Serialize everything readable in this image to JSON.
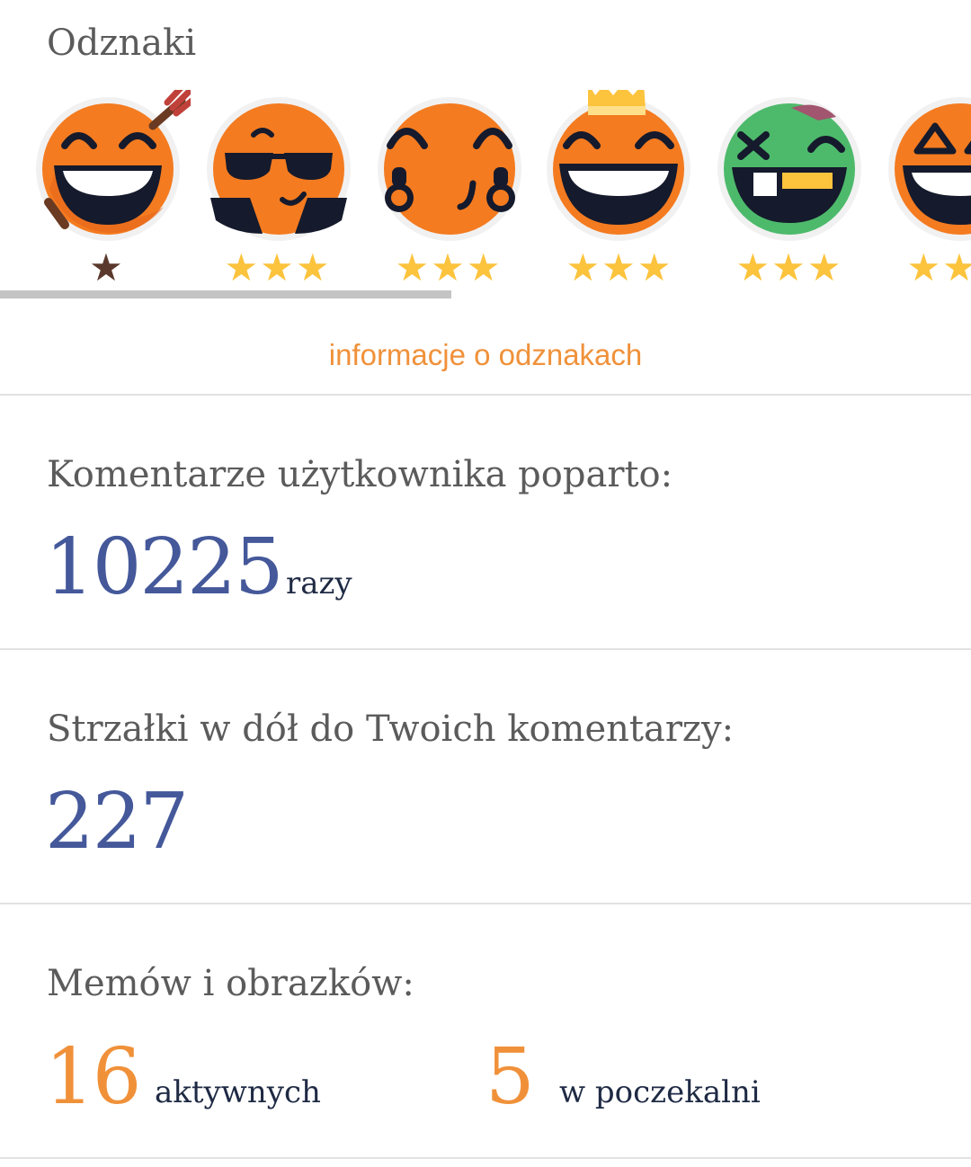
{
  "badges": {
    "title": "Odznaki",
    "items": [
      {
        "name": "arrow-badge-icon",
        "stars": "★",
        "star_color": "#5a392c"
      },
      {
        "name": "sunglasses-badge-icon",
        "stars": "★★★",
        "star_color": "#fcc33d"
      },
      {
        "name": "thumbs-up-badge-icon",
        "stars": "★★★",
        "star_color": "#fcc33d"
      },
      {
        "name": "crown-badge-icon",
        "stars": "★★★",
        "star_color": "#fcc33d"
      },
      {
        "name": "zombie-badge-icon",
        "stars": "★★★",
        "star_color": "#fcc33d"
      },
      {
        "name": "triangle-eyes-badge-icon",
        "stars": "★★★",
        "star_color": "#fcc33d"
      }
    ],
    "info_link": "informacje o odznakach"
  },
  "upvotes": {
    "label": "Komentarze użytkownika poparto:",
    "value": "10225",
    "unit": "razy"
  },
  "downvotes": {
    "label": "Strzałki w dół do Twoich komentarzy:",
    "value": "227"
  },
  "memes": {
    "label": "Memów i obrazków:",
    "active_value": "16",
    "active_unit": "aktywnych",
    "pending_value": "5",
    "pending_unit": "w poczekalni"
  },
  "colors": {
    "accent_orange": "#f0913a",
    "number_blue": "#44589a",
    "star_gold": "#fcc33d",
    "face_orange": "#f47b20",
    "face_green": "#4dba6b"
  }
}
